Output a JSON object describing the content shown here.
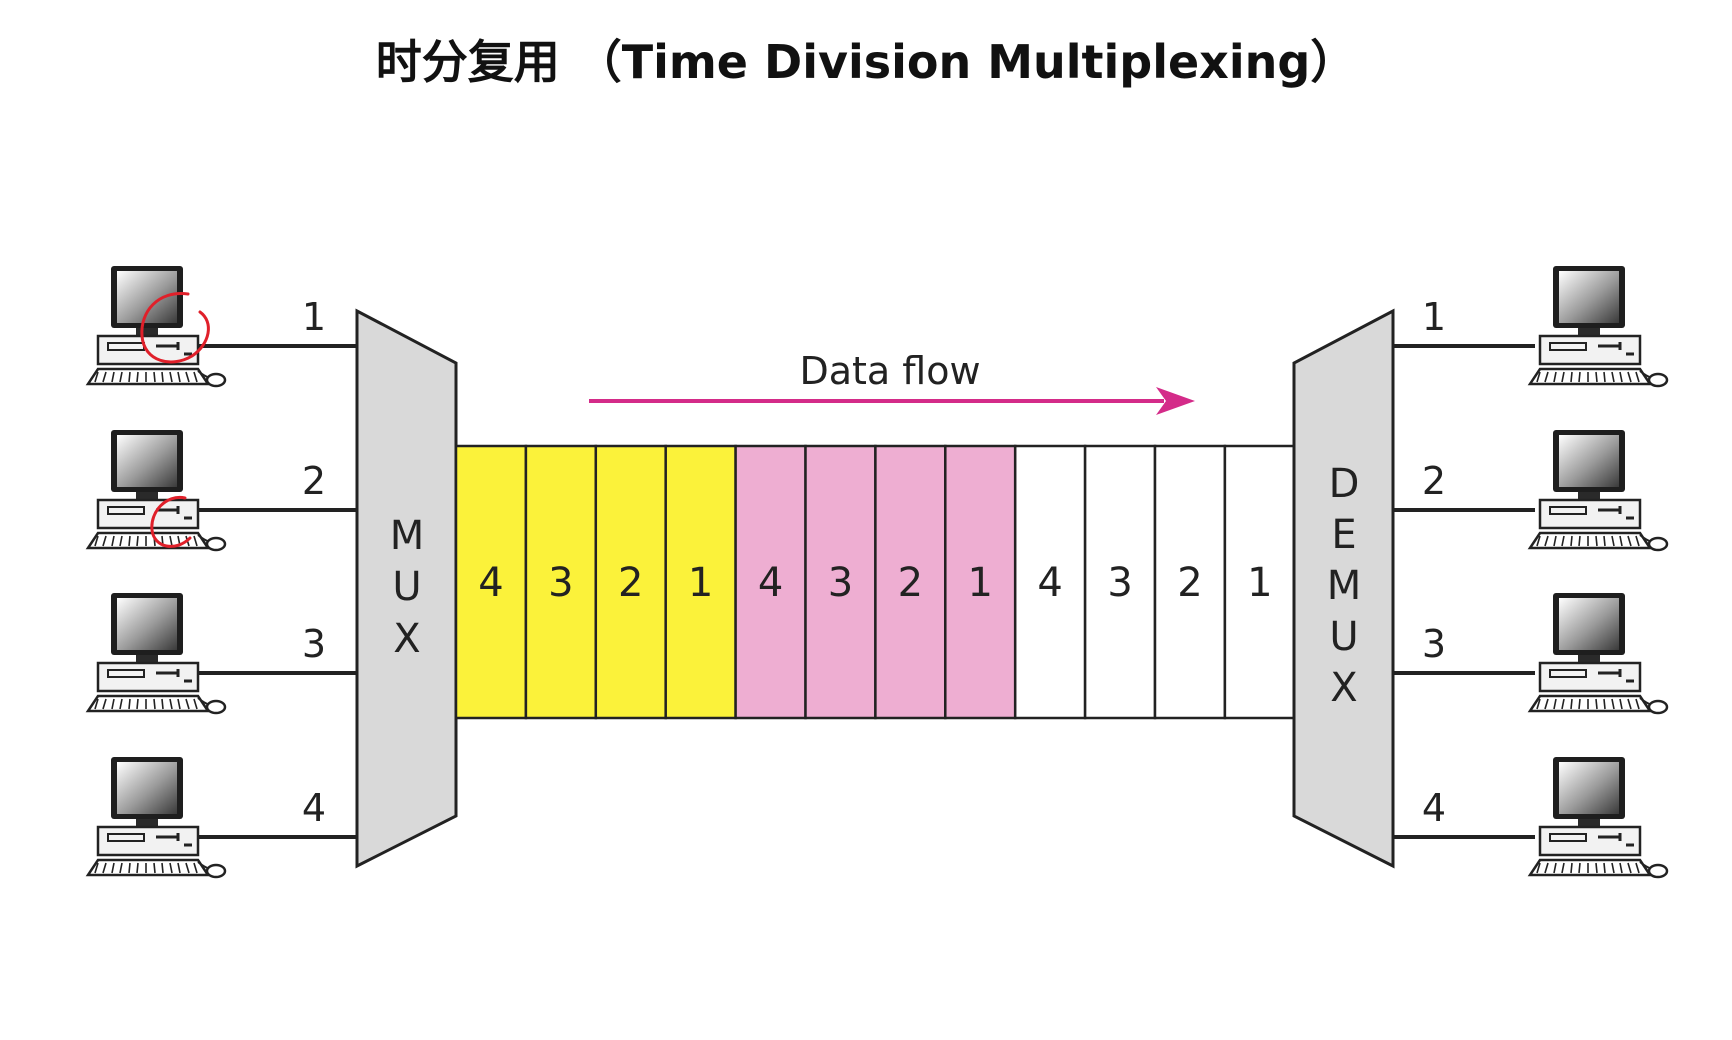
{
  "title": "时分复用 （Time Division Multiplexing）",
  "flow_label": "Data flow",
  "mux_label": "MUX",
  "demux_label": "DEMUX",
  "inputs": [
    "1",
    "2",
    "3",
    "4"
  ],
  "outputs": [
    "1",
    "2",
    "3",
    "4"
  ],
  "frames": [
    {
      "color": "#fbf23a",
      "slots": [
        "4",
        "3",
        "2",
        "1"
      ]
    },
    {
      "color": "#eeaed2",
      "slots": [
        "4",
        "3",
        "2",
        "1"
      ]
    },
    {
      "color": "#ffffff",
      "slots": [
        "4",
        "3",
        "2",
        "1"
      ]
    }
  ],
  "colors": {
    "arrow": "#d42b89",
    "mux_fill": "#d9d9d9",
    "line": "#222222",
    "annotation": "#e0202a"
  },
  "icons": {
    "station": "desktop-computer-icon"
  }
}
